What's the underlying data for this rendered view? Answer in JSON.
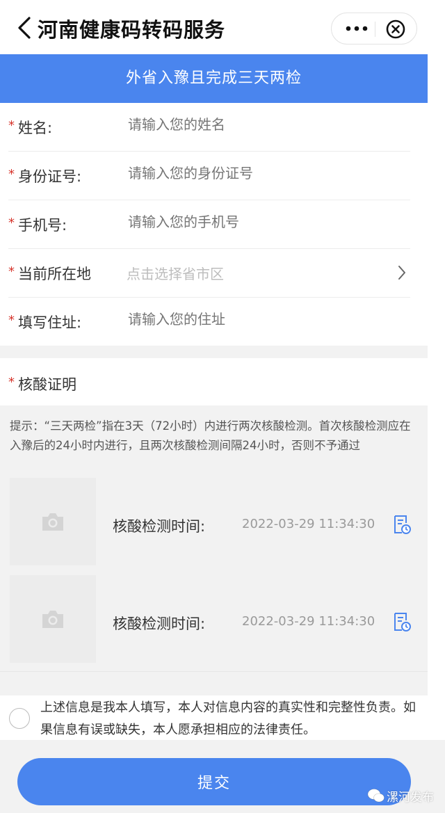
{
  "navbar": {
    "title": "河南健康码转码服务"
  },
  "banner": {
    "text": "外省入豫且完成三天两检"
  },
  "form": {
    "rows": [
      {
        "label": "姓名:",
        "placeholder": "请输入您的姓名"
      },
      {
        "label": "身份证号:",
        "placeholder": "请输入您的身份证号"
      },
      {
        "label": "手机号:",
        "placeholder": "请输入您的手机号"
      },
      {
        "label": "当前所在地",
        "placeholder": "点击选择省市区"
      },
      {
        "label": "填写住址:",
        "placeholder": "请输入您的住址"
      }
    ],
    "required_mark": "*"
  },
  "nucleic": {
    "section_label": "核酸证明",
    "tip": "提示：“三天两检”指在3天（72小时）内进行两次核酸检测。首次核酸检测应在入豫后的24小时内进行，且两次核酸检测间隔24小时，否则不予通过",
    "records": [
      {
        "label": "核酸检测时间:",
        "time": "2022-03-29 11:34:30"
      },
      {
        "label": "核酸检测时间:",
        "time": "2022-03-29 11:34:30"
      }
    ]
  },
  "agreement": {
    "text": "上述信息是我本人填写，本人对信息内容的真实性和完整性负责。如果信息有误或缺失，本人愿承担相应的法律责任。"
  },
  "submit": {
    "label": "提交"
  },
  "watermark": {
    "text": "漯河发布"
  },
  "colors": {
    "accent": "#4a85ee",
    "required": "#d6342b",
    "placeholder": "#bdbdbd"
  }
}
